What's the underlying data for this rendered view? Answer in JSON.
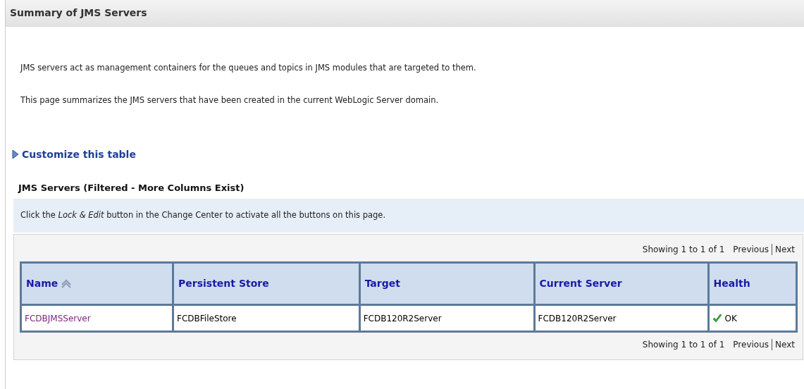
{
  "page_title": "Summary of JMS Servers",
  "intro": [
    "JMS servers act as management containers for the queues and topics in JMS modules that are targeted to them.",
    "This page summarizes the JMS servers that have been created in the current WebLogic Server domain."
  ],
  "customize_link": "Customize this table",
  "table_title": "JMS Servers (Filtered - More Columns Exist)",
  "info_message": "Click the *Lock & Edit* button in the Change Center to activate all the buttons on this page.",
  "pagination_top": {
    "summary": "Showing 1 to 1 of 1",
    "previous": "Previous",
    "next": "Next"
  },
  "columns": [
    {
      "label": "Name",
      "sorted_ascending": true
    },
    {
      "label": "Persistent Store",
      "sorted_ascending": false
    },
    {
      "label": "Target",
      "sorted_ascending": false
    },
    {
      "label": "Current Server",
      "sorted_ascending": false
    },
    {
      "label": "Health",
      "sorted_ascending": false
    }
  ],
  "rows": [
    {
      "cells": [
        {
          "kind": "link",
          "text": "FCDBJMSServer"
        },
        {
          "kind": "text",
          "text": "FCDBFileStore"
        },
        {
          "kind": "text",
          "text": "FCDB120R2Server"
        },
        {
          "kind": "text",
          "text": "FCDB120R2Server"
        },
        {
          "kind": "health_ok",
          "text": "OK"
        }
      ]
    }
  ],
  "pagination_bottom": {
    "summary": "Showing 1 to 1 of 1",
    "previous": "Previous",
    "next": "Next"
  }
}
